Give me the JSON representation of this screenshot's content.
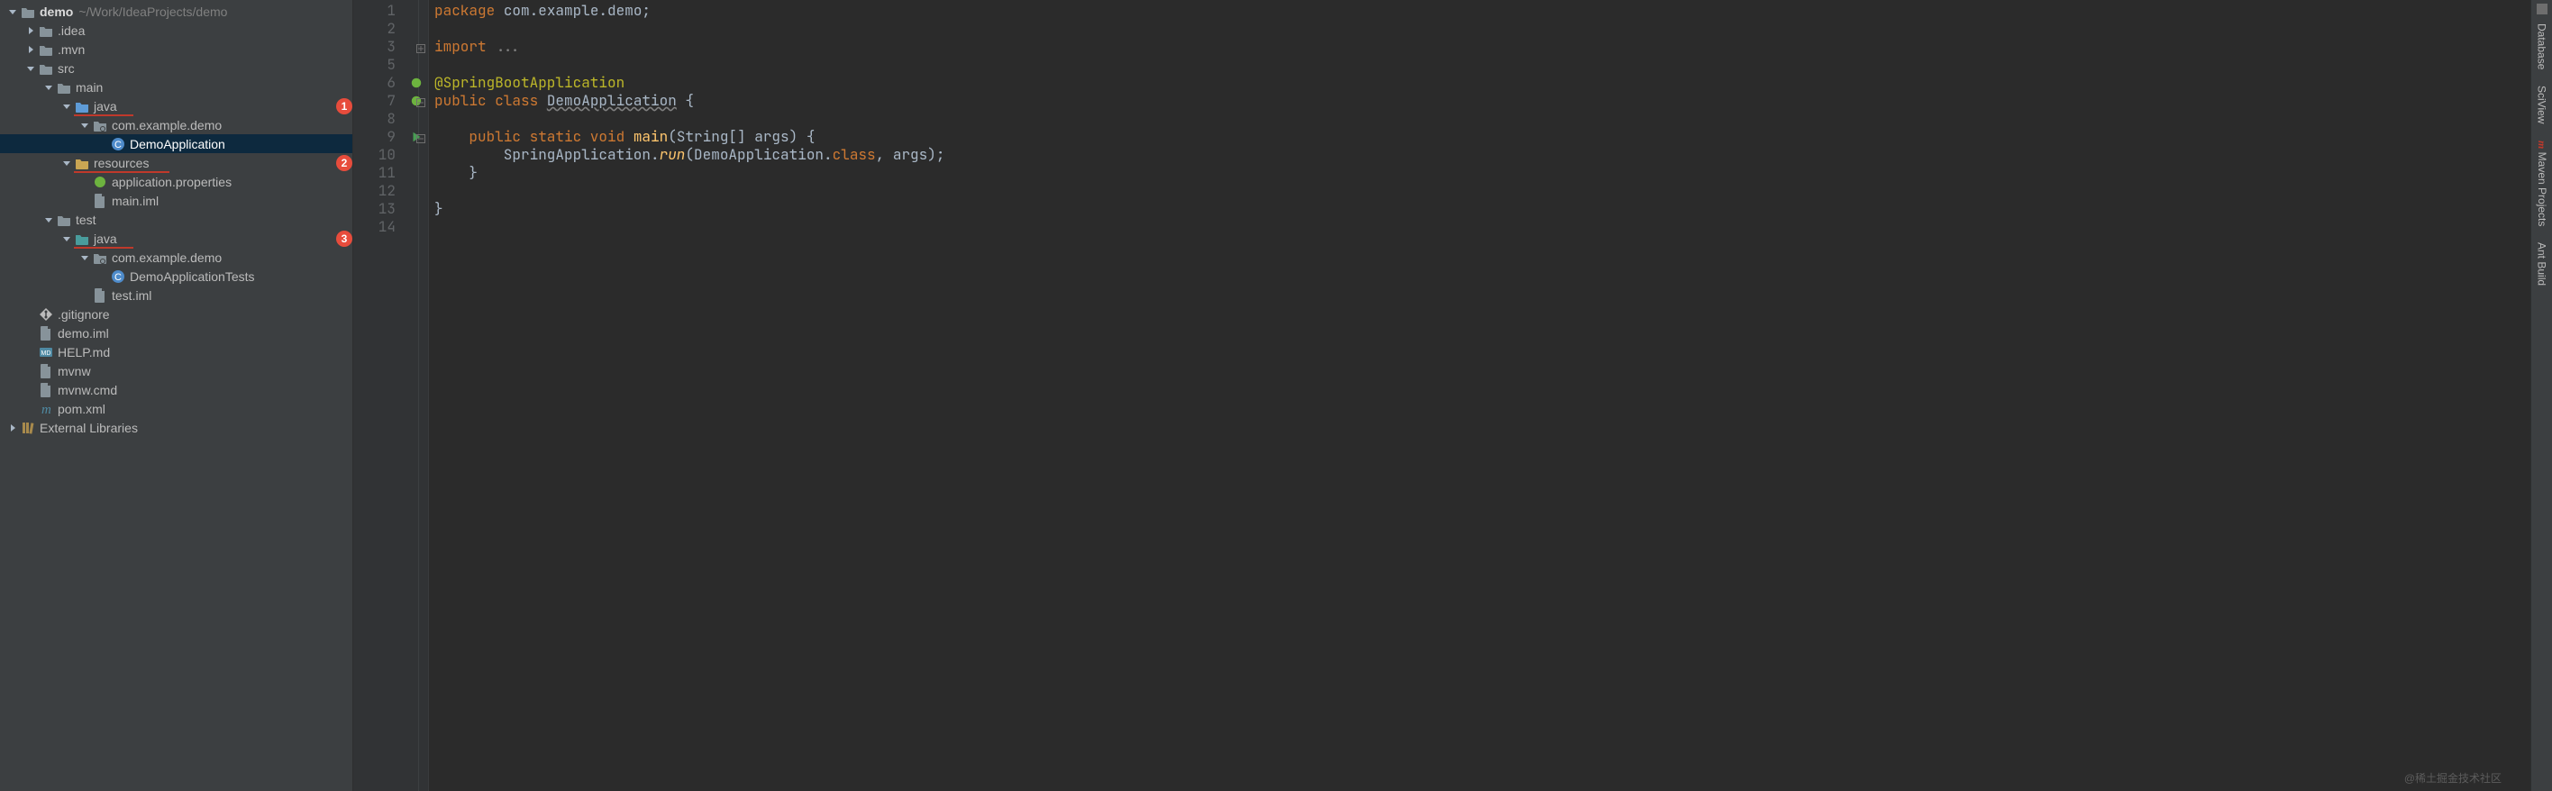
{
  "project": {
    "root": {
      "name": "demo",
      "path": "~/Work/IdeaProjects/demo"
    },
    "items": [
      {
        "id": "root",
        "depth": 0,
        "kind": "root",
        "label": "demo",
        "suffix": "~/Work/IdeaProjects/demo",
        "expanded": true
      },
      {
        "id": "idea",
        "depth": 1,
        "kind": "folder",
        "label": ".idea",
        "expanded": false
      },
      {
        "id": "mvn",
        "depth": 1,
        "kind": "folder",
        "label": ".mvn",
        "expanded": false
      },
      {
        "id": "src",
        "depth": 1,
        "kind": "folder",
        "label": "src",
        "expanded": true
      },
      {
        "id": "main",
        "depth": 2,
        "kind": "folder",
        "label": "main",
        "expanded": true
      },
      {
        "id": "java1",
        "depth": 3,
        "kind": "srcroot",
        "label": "java",
        "expanded": true,
        "badge": "1",
        "underline": true
      },
      {
        "id": "pkg1",
        "depth": 4,
        "kind": "package",
        "label": "com.example.demo",
        "expanded": true
      },
      {
        "id": "demoapp",
        "depth": 5,
        "kind": "class",
        "label": "DemoApplication",
        "selected": true
      },
      {
        "id": "res",
        "depth": 3,
        "kind": "resroot",
        "label": "resources",
        "expanded": true,
        "badge": "2",
        "underline": true
      },
      {
        "id": "appprop",
        "depth": 4,
        "kind": "spring",
        "label": "application.properties"
      },
      {
        "id": "mainiml",
        "depth": 4,
        "kind": "file",
        "label": "main.iml"
      },
      {
        "id": "test",
        "depth": 2,
        "kind": "folder",
        "label": "test",
        "expanded": true
      },
      {
        "id": "java2",
        "depth": 3,
        "kind": "testroot",
        "label": "java",
        "expanded": true,
        "badge": "3",
        "underline": true
      },
      {
        "id": "pkg2",
        "depth": 4,
        "kind": "package",
        "label": "com.example.demo",
        "expanded": true
      },
      {
        "id": "tests",
        "depth": 5,
        "kind": "class",
        "label": "DemoApplicationTests"
      },
      {
        "id": "testiml",
        "depth": 4,
        "kind": "file",
        "label": "test.iml"
      },
      {
        "id": "gitig",
        "depth": 1,
        "kind": "file",
        "label": ".gitignore"
      },
      {
        "id": "demoiml",
        "depth": 1,
        "kind": "file",
        "label": "demo.iml"
      },
      {
        "id": "help",
        "depth": 1,
        "kind": "md",
        "label": "HELP.md"
      },
      {
        "id": "mvnw",
        "depth": 1,
        "kind": "file",
        "label": "mvnw"
      },
      {
        "id": "mvnwcmd",
        "depth": 1,
        "kind": "file",
        "label": "mvnw.cmd"
      },
      {
        "id": "pom",
        "depth": 1,
        "kind": "pom",
        "label": "pom.xml"
      }
    ],
    "external_libs": "External Libraries"
  },
  "editor": {
    "lines": [
      {
        "n": 1,
        "segs": [
          [
            "kw",
            "package "
          ],
          [
            "pkg",
            "com.example.demo"
          ],
          [
            "pkg",
            ";"
          ]
        ]
      },
      {
        "n": 2,
        "segs": []
      },
      {
        "n": 3,
        "segs": [
          [
            "kw",
            "import "
          ],
          [
            "str",
            "..."
          ]
        ],
        "fold": "plus"
      },
      {
        "n": 5,
        "segs": []
      },
      {
        "n": 6,
        "segs": [
          [
            "ann",
            "@SpringBootApplication"
          ]
        ],
        "gutter": "spring"
      },
      {
        "n": 7,
        "segs": [
          [
            "kw",
            "public class "
          ],
          [
            "wavy",
            "DemoApplication"
          ],
          [
            "pkg",
            " {"
          ]
        ],
        "gutter": "spring-run",
        "fold": "minus"
      },
      {
        "n": 8,
        "segs": []
      },
      {
        "n": 9,
        "segs": [
          [
            "pkg",
            "    "
          ],
          [
            "kw",
            "public static void "
          ],
          [
            "mth",
            "main"
          ],
          [
            "pkg",
            "(String[] args) {"
          ]
        ],
        "gutter": "run",
        "fold": "minus"
      },
      {
        "n": 10,
        "segs": [
          [
            "pkg",
            "        SpringApplication."
          ],
          [
            "italic",
            "run"
          ],
          [
            "pkg",
            "(DemoApplication."
          ],
          [
            "kw",
            "class"
          ],
          [
            "pkg",
            ", args);"
          ]
        ]
      },
      {
        "n": 11,
        "segs": [
          [
            "pkg",
            "    }"
          ]
        ]
      },
      {
        "n": 12,
        "segs": []
      },
      {
        "n": 13,
        "segs": [
          [
            "pkg",
            "}"
          ]
        ]
      },
      {
        "n": 14,
        "segs": []
      }
    ]
  },
  "rail": {
    "items": [
      "Database",
      "SciView",
      "Maven Projects",
      "Ant Build"
    ]
  },
  "watermark": "@稀土掘金技术社区"
}
